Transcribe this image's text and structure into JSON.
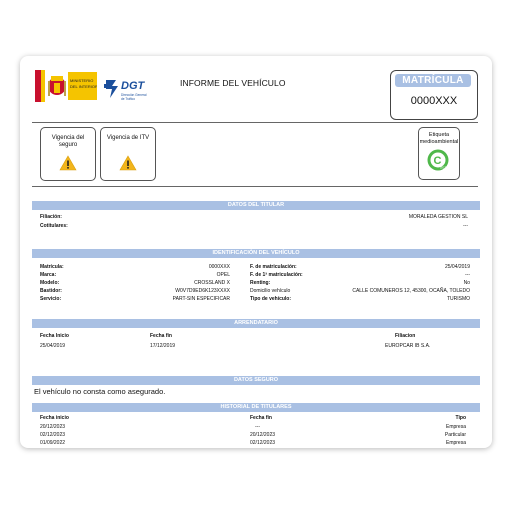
{
  "header": {
    "title": "INFORME DEL VEHÍCULO",
    "ministry_logo_text": "MINISTERIO DEL INTERIOR",
    "dgt_logo_text": "DGT",
    "dgt_logo_subtext": "Dirección General de Tráfico"
  },
  "plate": {
    "label": "MATRÍCULA",
    "value": "0000XXX"
  },
  "cards": {
    "insurance": "Vigencia del seguro",
    "itv": "Vigencia de ITV"
  },
  "eco": {
    "label": "Etiqueta medioambiental",
    "badge_letter": "C",
    "badge_text": "DGT"
  },
  "titular": {
    "heading": "DATOS DEL TITULAR",
    "filiacion_label": "Filiación:",
    "filiacion_value": "MORALEDA GESTION SL",
    "cotitulares_label": "Cotitulares:",
    "cotitulares_value": "---"
  },
  "vehiculo": {
    "heading": "IDENTIFICACIÓN DEL VEHÍCULO",
    "left": [
      {
        "label": "Matrícula:",
        "value": "0000XXX"
      },
      {
        "label": "Marca:",
        "value": "OPEL"
      },
      {
        "label": "Modelo:",
        "value": "CROSSLAND X"
      },
      {
        "label": "Bastidor:",
        "value": "W0V7D9ED6K123XXXX"
      },
      {
        "label": "Servicio:",
        "value": "PART-SIN ESPECIFICAR"
      }
    ],
    "right": [
      {
        "label": "F. de matriculación:",
        "value": "25/04/2019"
      },
      {
        "label": "F. de 1ª matriculación:",
        "value": "---"
      },
      {
        "label": "Renting:",
        "value": "No"
      },
      {
        "label": "Domicilio vehículo",
        "value": "CALLE COMUNEROS 12, 45300, OCAÑA, TOLEDO"
      },
      {
        "label": "Tipo de vehículo:",
        "value": "TURISMO"
      }
    ]
  },
  "arrendatario": {
    "heading": "ARRENDATARIO",
    "col1": "Fecha Inicio",
    "col2": "Fecha fin",
    "col3": "Filiacion",
    "row": {
      "inicio": "25/04/2019",
      "fin": "17/12/2019",
      "filiacion": "EUROPCAR IB S.A."
    }
  },
  "seguro": {
    "heading": "DATOS SEGURO",
    "message": "El vehículo no consta como asegurado."
  },
  "historial": {
    "heading": "HISTORIAL DE TITULARES",
    "col1": "Fecha inicio",
    "col2": "Fecha fin",
    "col3": "Tipo",
    "rows": [
      {
        "inicio": "20/12/2023",
        "fin": "---",
        "tipo": "Empresa"
      },
      {
        "inicio": "02/12/2023",
        "fin": "20/12/2023",
        "tipo": "Particular"
      },
      {
        "inicio": "01/09/2022",
        "fin": "02/12/2023",
        "tipo": "Empresa"
      }
    ]
  },
  "colors": {
    "section_bar": "#a9c0e3",
    "warning": "#f2b51c",
    "eco_green": "#4fb84a",
    "dgt_blue": "#1b4f9c"
  }
}
